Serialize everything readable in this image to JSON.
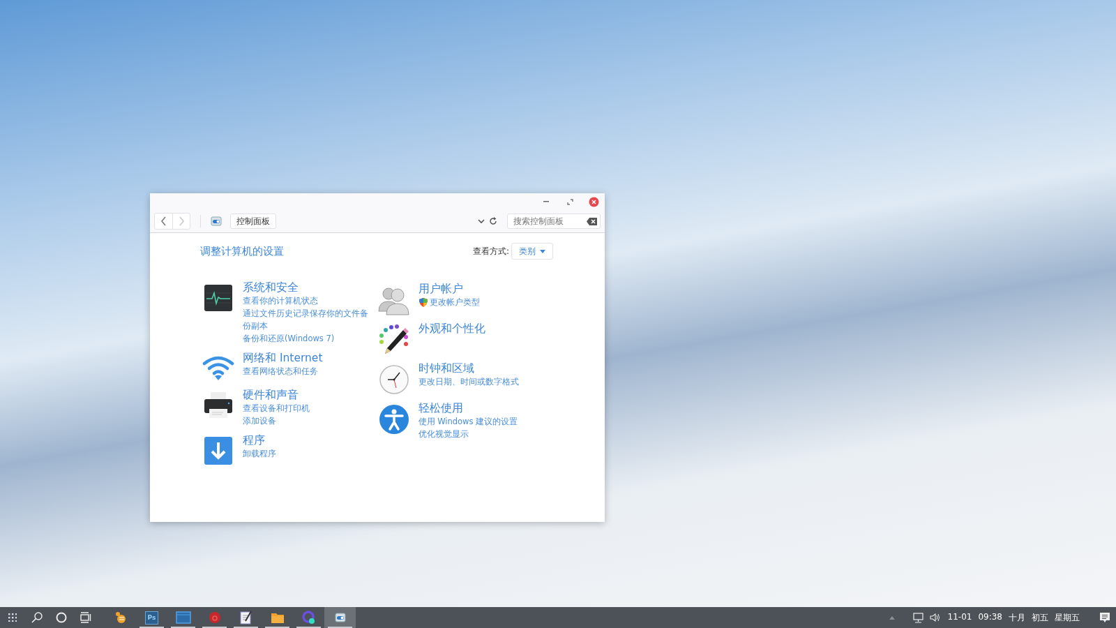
{
  "window": {
    "nav": [
      {
        "kind": "back",
        "disabled": false
      },
      {
        "kind": "forward",
        "disabled": true
      }
    ],
    "breadcrumb": "控制面板",
    "search": {
      "placeholder": "搜索控制面板"
    },
    "heading": "调整计算机的设置",
    "view_by": {
      "label": "查看方式:",
      "value": "类别"
    },
    "columns": [
      [
        {
          "title": "系统和安全",
          "links": [
            {
              "text": "查看你的计算机状态",
              "kind": "link"
            },
            {
              "text": "通过文件历史记录保存你的文件备份副本",
              "kind": "link"
            },
            {
              "text": "备份和还原(Windows 7)",
              "kind": "link"
            }
          ]
        },
        {
          "title": "网络和 Internet",
          "links": [
            {
              "text": "查看网络状态和任务",
              "kind": "link"
            }
          ]
        },
        {
          "title": "硬件和声音",
          "links": [
            {
              "text": "查看设备和打印机",
              "kind": "link"
            },
            {
              "text": "添加设备",
              "kind": "link"
            }
          ]
        },
        {
          "title": "程序",
          "links": [
            {
              "text": "卸载程序",
              "kind": "link"
            }
          ]
        }
      ],
      [
        {
          "title": "用户帐户",
          "links": [
            {
              "text": "更改帐户类型",
              "kind": "admin"
            }
          ]
        },
        {
          "title": "外观和个性化"
        },
        {
          "title": "时钟和区域",
          "links": [
            {
              "text": "更改日期、时间或数字格式",
              "kind": "link"
            }
          ]
        },
        {
          "title": "轻松使用",
          "links": [
            {
              "text": "使用 Windows 建议的设置",
              "kind": "link"
            },
            {
              "text": "优化视觉显示",
              "kind": "link"
            }
          ]
        }
      ]
    ]
  },
  "taskbar": {
    "apps": [
      {
        "kind": "bee",
        "running": false,
        "selected": false
      },
      {
        "kind": "ps",
        "label": "Ps",
        "running": true,
        "selected": false
      },
      {
        "kind": "window",
        "running": true,
        "selected": false
      },
      {
        "kind": "red",
        "running": true,
        "selected": false
      },
      {
        "kind": "notepad",
        "running": true,
        "selected": false
      },
      {
        "kind": "folder",
        "running": true,
        "selected": false
      },
      {
        "kind": "orb",
        "running": true,
        "selected": false
      },
      {
        "kind": "control",
        "running": true,
        "selected": true
      }
    ],
    "tray": {
      "date": "11-01",
      "time": "09:38",
      "lunar_month": "十月",
      "lunar_day": "初五",
      "weekday": "星期五"
    }
  }
}
